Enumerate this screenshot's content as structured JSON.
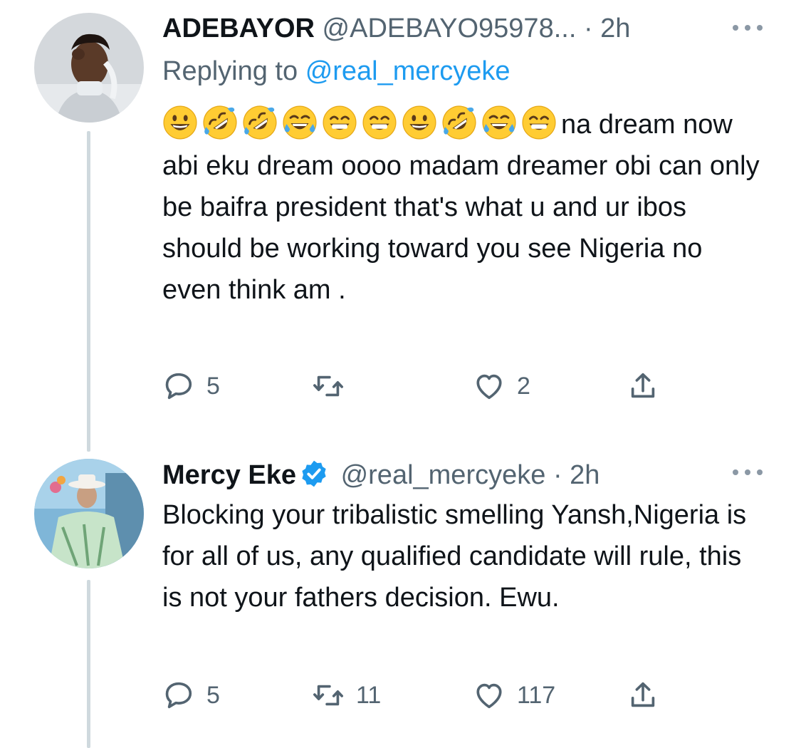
{
  "tweets": [
    {
      "display_name": "ADEBAYOR",
      "handle": "@ADEBAYO95978...",
      "separator": "·",
      "time": "2h",
      "verified": false,
      "replying_label": "Replying to",
      "replying_handle": "@real_mercyeke",
      "emojis": [
        "grinning-face",
        "rofl-face",
        "rofl-face",
        "tears-of-joy-face",
        "beaming-face",
        "beaming-face",
        "grinning-face",
        "rofl-face",
        "tears-of-joy-face",
        "beaming-face"
      ],
      "text": "na dream now abi eku dream oooo madam dreamer obi can only be baifra president that's what u and ur ibos should be working toward you see Nigeria no even think am .",
      "replies": "5",
      "retweets": "",
      "likes": "2"
    },
    {
      "display_name": "Mercy Eke",
      "handle": "@real_mercyeke",
      "separator": "·",
      "time": "2h",
      "verified": true,
      "text": "Blocking your tribalistic smelling Yansh,Nigeria is for all of us, any qualified candidate will rule, this is not your fathers decision. Ewu.",
      "replies": "5",
      "retweets": "11",
      "likes": "117"
    }
  ],
  "colors": {
    "link": "#1d9bf0",
    "secondary_text": "#536471",
    "thread_line": "#cfd9de",
    "verified_badge": "#1d9bf0"
  }
}
